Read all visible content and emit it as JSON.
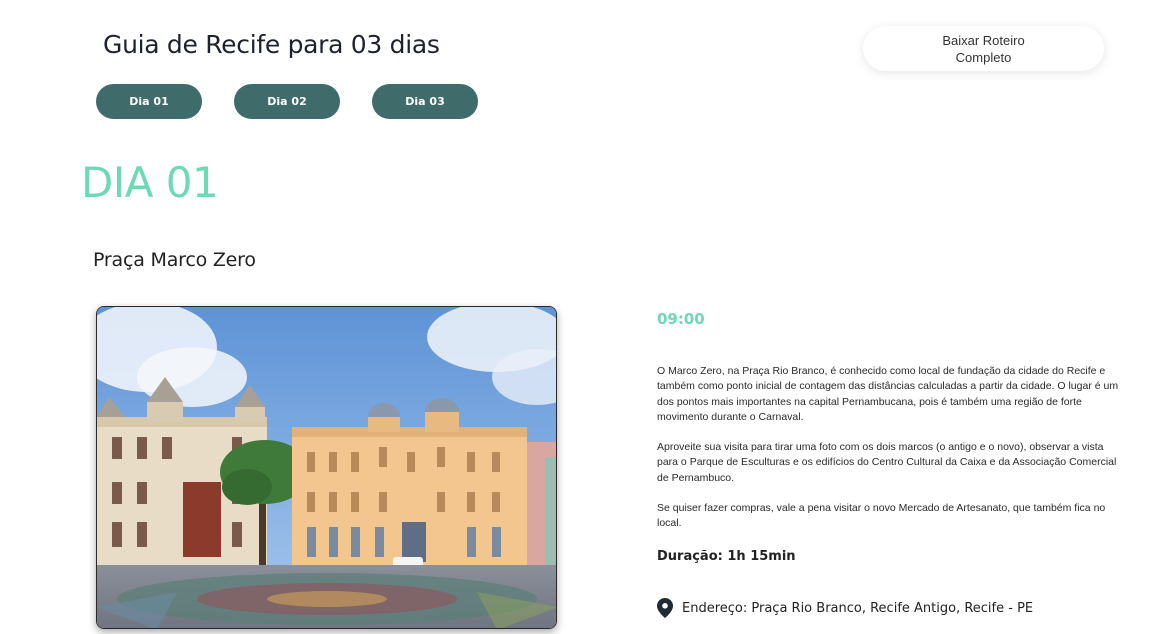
{
  "header": {
    "title": "Guia de Recife para 03 dias",
    "download_label_line1": "Baixar Roteiro",
    "download_label_line2": "Completo"
  },
  "tabs": [
    {
      "label": "Dia 01"
    },
    {
      "label": "Dia 02"
    },
    {
      "label": "Dia 03"
    }
  ],
  "day": {
    "heading": "DIA 01",
    "place": {
      "name": "Praça Marco Zero",
      "time": "09:00",
      "paragraphs": [
        "O Marco Zero, na Praça Rio Branco, é conhecido como local de fundação da cidade do Recife e também como ponto inicial de contagem das distâncias calculadas a partir da cidade. O lugar é um dos pontos mais importantes na capital Pernambucana, pois é também uma região de forte movimento durante o Carnaval.",
        "Aproveite sua visita para tirar uma foto com os dois marcos (o antigo e o novo), observar a vista para o Parque de Esculturas e os edifícios do Centro Cultural da Caixa e da Associação Comercial de Pernambuco.",
        "Se quiser fazer compras, vale a pena visitar o novo Mercado de Artesanato, que também fica no local."
      ],
      "duration": "Duração: 1h 15min",
      "address": "Endereço: Praça Rio Branco, Recife Antigo, Recife - PE",
      "address_icon": "map-pin-icon"
    }
  },
  "colors": {
    "accent": "#6fd9b4",
    "tab_bg": "#3f6b6b"
  }
}
